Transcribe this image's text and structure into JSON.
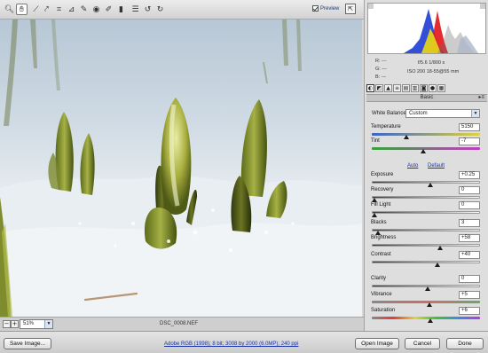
{
  "toolbar": {
    "tools": [
      {
        "name": "zoom-tool-icon",
        "glyph": "🔍︎"
      },
      {
        "name": "hand-tool-icon",
        "glyph": "✋︎"
      },
      {
        "name": "white-balance-tool-icon",
        "glyph": "⟋"
      },
      {
        "name": "color-sampler-tool-icon",
        "glyph": "⤤"
      },
      {
        "name": "crop-tool-icon",
        "glyph": "⌗"
      },
      {
        "name": "straighten-tool-icon",
        "glyph": "⊿"
      },
      {
        "name": "retouch-tool-icon",
        "glyph": "✎"
      },
      {
        "name": "red-eye-tool-icon",
        "glyph": "◉"
      },
      {
        "name": "adjustment-brush-icon",
        "glyph": "✐"
      },
      {
        "name": "graduated-filter-icon",
        "glyph": "▮"
      },
      {
        "name": "preferences-icon",
        "glyph": "☰"
      },
      {
        "name": "rotate-left-icon",
        "glyph": "↺"
      },
      {
        "name": "rotate-right-icon",
        "glyph": "↻"
      }
    ],
    "preview_label": "Preview"
  },
  "status": {
    "zoom_value": "51%",
    "filename": "DSC_0008.NEF"
  },
  "histogram_info": {
    "r_label": "R:",
    "g_label": "G:",
    "b_label": "B:",
    "r_value": "---",
    "g_value": "---",
    "b_value": "---",
    "aperture_shutter": "f/5.6   1/800 s",
    "iso_lens": "ISO 200    18-55@55 mm"
  },
  "panel": {
    "section_title": "Basic",
    "white_balance_label": "White Balance:",
    "white_balance_value": "Custom",
    "auto_label": "Auto",
    "default_label": "Default",
    "sliders": [
      {
        "label": "Temperature",
        "value": "5150",
        "pos": 0.3
      },
      {
        "label": "Tint",
        "value": "-7",
        "pos": 0.46
      },
      {
        "label": "Exposure",
        "value": "+0.25",
        "pos": 0.53
      },
      {
        "label": "Recovery",
        "value": "0",
        "pos": 0.0
      },
      {
        "label": "Fill Light",
        "value": "0",
        "pos": 0.0
      },
      {
        "label": "Blacks",
        "value": "3",
        "pos": 0.03
      },
      {
        "label": "Brightness",
        "value": "+58",
        "pos": 0.62
      },
      {
        "label": "Contrast",
        "value": "+40",
        "pos": 0.6
      },
      {
        "label": "Clarity",
        "value": "0",
        "pos": 0.5
      },
      {
        "label": "Vibrance",
        "value": "+5",
        "pos": 0.52
      },
      {
        "label": "Saturation",
        "value": "+6",
        "pos": 0.53
      }
    ]
  },
  "bottom": {
    "save_label": "Save Image...",
    "workflow_link": "Adobe RGB (1998); 8 bit; 3008 by 2000 (6.0MP); 240 ppi",
    "open_label": "Open Image",
    "cancel_label": "Cancel",
    "done_label": "Done"
  },
  "colors": {
    "snow": "#e6ecf1",
    "sky_blue": "#c7d5e1",
    "sprout_green": "#8d9a3a",
    "link_blue": "#1a33a6"
  }
}
